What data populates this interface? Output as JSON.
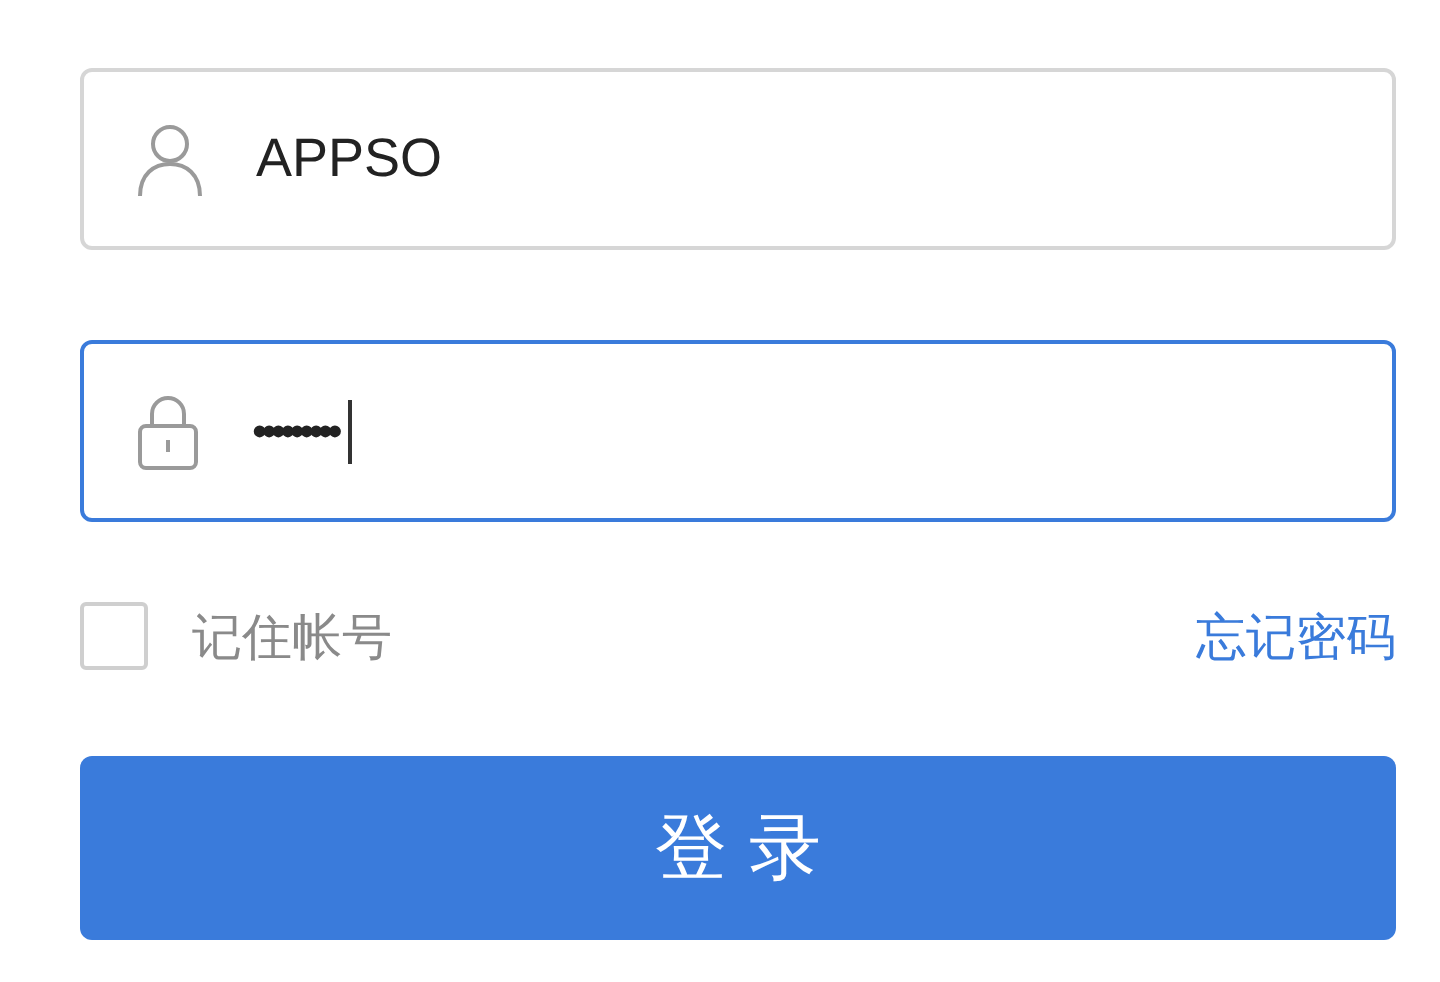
{
  "fields": [
    {
      "kind": "username",
      "value": "APPSO",
      "focused": false
    },
    {
      "kind": "password",
      "value": "•••••••••",
      "focused": true
    }
  ],
  "remember": {
    "label": "记住帐号",
    "checked": false
  },
  "forgot_link": "忘记密码",
  "login_button": "登 录"
}
